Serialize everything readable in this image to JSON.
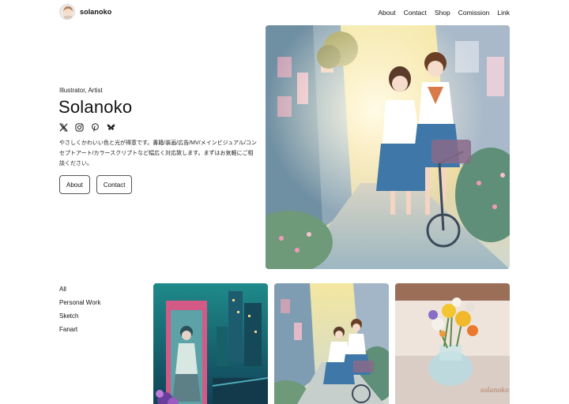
{
  "header": {
    "brand": "solanoko",
    "nav": [
      "About",
      "Contact",
      "Shop",
      "Comission",
      "Link"
    ]
  },
  "hero": {
    "subtitle": "Illustrator, Artist",
    "title": "Solanoko",
    "socials": [
      "x-icon",
      "instagram-icon",
      "pinterest-icon",
      "bluesky-icon"
    ],
    "description": "やさしくかわいい色と光が得意です。書籍/装画/広告/MV/メインビジュアル/コンセプトアート/カラースクリプトなど幅広く対応致します。まずはお気軽にご相談ください。",
    "buttons": {
      "about": "About",
      "contact": "Contact"
    }
  },
  "categories": [
    "All",
    "Personal Work",
    "Sketch",
    "Fanart"
  ],
  "gallery": {
    "signature": "solanoko"
  },
  "colors": {
    "text": "#111111",
    "button_border": "#555555",
    "background": "#ffffff"
  }
}
